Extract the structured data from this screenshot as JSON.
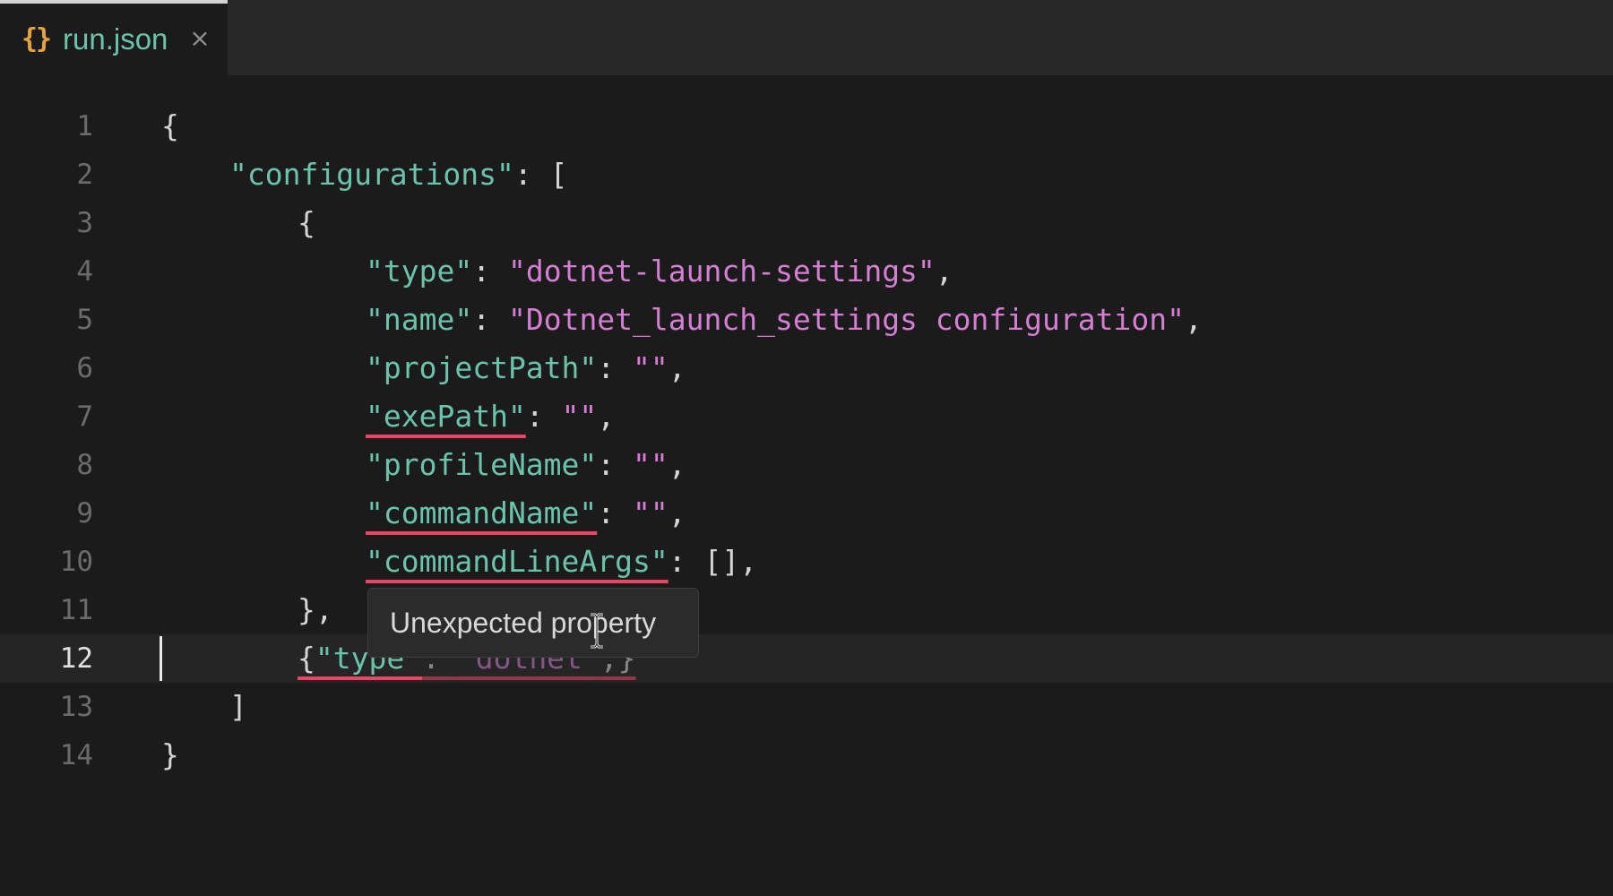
{
  "tab": {
    "icon": "{}",
    "icon_name": "json-braces-icon",
    "label": "run.json",
    "close_glyph": "×"
  },
  "editor": {
    "active_line": 12,
    "lines": [
      {
        "n": "1",
        "tokens": [
          [
            "p",
            "{"
          ]
        ]
      },
      {
        "n": "2",
        "tokens": [
          [
            "k",
            "\"configurations\""
          ],
          [
            "p",
            ": ["
          ]
        ]
      },
      {
        "n": "3",
        "tokens": [
          [
            "p",
            "{"
          ]
        ]
      },
      {
        "n": "4",
        "tokens": [
          [
            "k",
            "\"type\""
          ],
          [
            "p",
            ": "
          ],
          [
            "s",
            "\"dotnet-launch-settings\""
          ],
          [
            "p",
            ","
          ]
        ]
      },
      {
        "n": "5",
        "tokens": [
          [
            "k",
            "\"name\""
          ],
          [
            "p",
            ": "
          ],
          [
            "s",
            "\"Dotnet_launch_settings configuration\""
          ],
          [
            "p",
            ","
          ]
        ]
      },
      {
        "n": "6",
        "tokens": [
          [
            "k",
            "\"projectPath\""
          ],
          [
            "p",
            ": "
          ],
          [
            "s",
            "\"\""
          ],
          [
            "p",
            ","
          ]
        ]
      },
      {
        "n": "7",
        "tokens": [
          [
            "k err",
            "\"exePath\""
          ],
          [
            "p",
            ": "
          ],
          [
            "s",
            "\"\""
          ],
          [
            "p",
            ","
          ]
        ]
      },
      {
        "n": "8",
        "tokens": [
          [
            "k",
            "\"profileName\""
          ],
          [
            "p",
            ": "
          ],
          [
            "s",
            "\"\""
          ],
          [
            "p",
            ","
          ]
        ]
      },
      {
        "n": "9",
        "tokens": [
          [
            "k err",
            "\"commandName\""
          ],
          [
            "p",
            ": "
          ],
          [
            "s",
            "\"\""
          ],
          [
            "p",
            ","
          ]
        ]
      },
      {
        "n": "10",
        "tokens": [
          [
            "k err",
            "\"commandLineArgs\""
          ],
          [
            "p",
            ": [],"
          ]
        ]
      },
      {
        "n": "11",
        "tokens": [
          [
            "p",
            "},"
          ]
        ]
      },
      {
        "n": "12",
        "tokens": [
          [
            "p err",
            "{"
          ],
          [
            "k err",
            "\"type\""
          ],
          [
            "p err faded",
            ": "
          ],
          [
            "s err faded",
            "\"dotnet\""
          ],
          [
            "p err faded",
            ",}"
          ]
        ]
      },
      {
        "n": "13",
        "tokens": [
          [
            "p",
            "]"
          ]
        ]
      },
      {
        "n": "14",
        "tokens": [
          [
            "p",
            "}"
          ]
        ]
      }
    ],
    "indents": [
      0,
      1,
      2,
      3,
      3,
      3,
      3,
      3,
      3,
      3,
      2,
      2,
      1,
      0
    ]
  },
  "tooltip": {
    "text": "Unexpected property"
  },
  "colors": {
    "background": "#1b1b1b",
    "tabbar": "#282828",
    "key": "#6cc3ac",
    "string": "#d57ed4",
    "punctuation": "#d4d4d4",
    "error_underline": "#ee4466",
    "json_icon": "#e6a23c"
  }
}
